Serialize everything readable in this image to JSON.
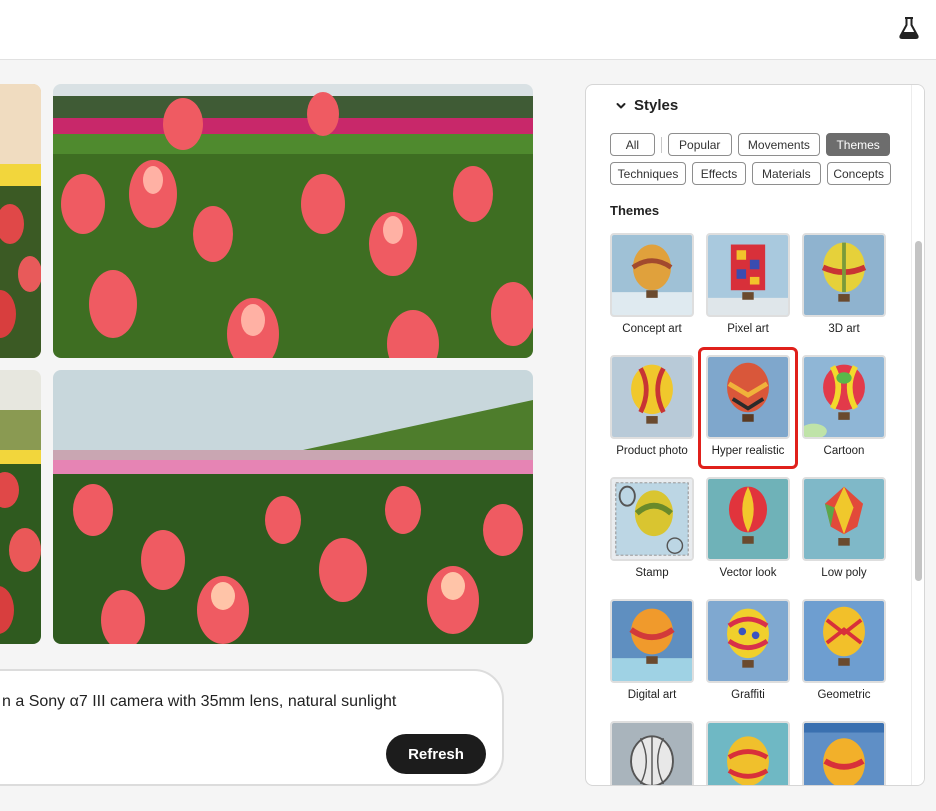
{
  "header": {
    "labs_icon": "flask-icon"
  },
  "prompt": {
    "text": "n a Sony α7 III camera with 35mm lens, natural sunlight",
    "refresh_label": "Refresh"
  },
  "styles_panel": {
    "title": "Styles",
    "filters_row1": [
      "All",
      "Popular",
      "Movements",
      "Themes"
    ],
    "filters_row2": [
      "Techniques",
      "Effects",
      "Materials",
      "Concepts"
    ],
    "active_filter": "Themes",
    "section_title": "Themes",
    "themes": [
      "Concept art",
      "Pixel art",
      "3D art",
      "Product photo",
      "Hyper realistic",
      "Cartoon",
      "Stamp",
      "Vector look",
      "Low poly",
      "Digital art",
      "Graffiti",
      "Geometric",
      "",
      "",
      ""
    ],
    "selected_theme": "Hyper realistic"
  },
  "colors": {
    "highlight": "#e0201b",
    "chip_active": "#6d6d6d",
    "button": "#1c1c1c"
  }
}
